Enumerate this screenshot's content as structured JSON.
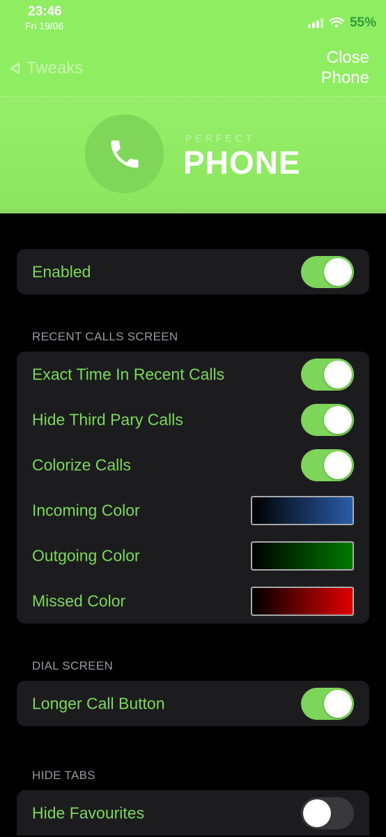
{
  "status_bar": {
    "time": "23:46",
    "date": "Fri 19/06",
    "battery": "55%"
  },
  "nav": {
    "back_label": "Tweaks",
    "close_label_line1": "Close",
    "close_label_line2": "Phone"
  },
  "banner": {
    "subtitle": "PERFECT",
    "title": "PHONE"
  },
  "enabled": {
    "label": "Enabled",
    "on": true
  },
  "sections": {
    "recent": {
      "header": "RECENT CALLS SCREEN",
      "exact_time": "Exact Time In Recent Calls",
      "hide_third_party": "Hide Third Pary Calls",
      "colorize": "Colorize Calls",
      "incoming": "Incoming Color",
      "outgoing": "Outgoing Color",
      "missed": "Missed Color"
    },
    "dial": {
      "header": "DIAL SCREEN",
      "longer_call_button": "Longer Call Button"
    },
    "hide_tabs": {
      "header": "HIDE TABS",
      "hide_favourites": "Hide Favourites"
    }
  },
  "colors": {
    "accent": "#7cd85a",
    "header_bg": "#8fed62",
    "incoming": "#2b5ca8",
    "outgoing": "#007a00",
    "missed": "#e00000"
  },
  "icons": {
    "back": "back-triangle-icon",
    "logo": "phone-handset-icon",
    "signal": "signal-icon",
    "wifi": "wifi-icon"
  }
}
